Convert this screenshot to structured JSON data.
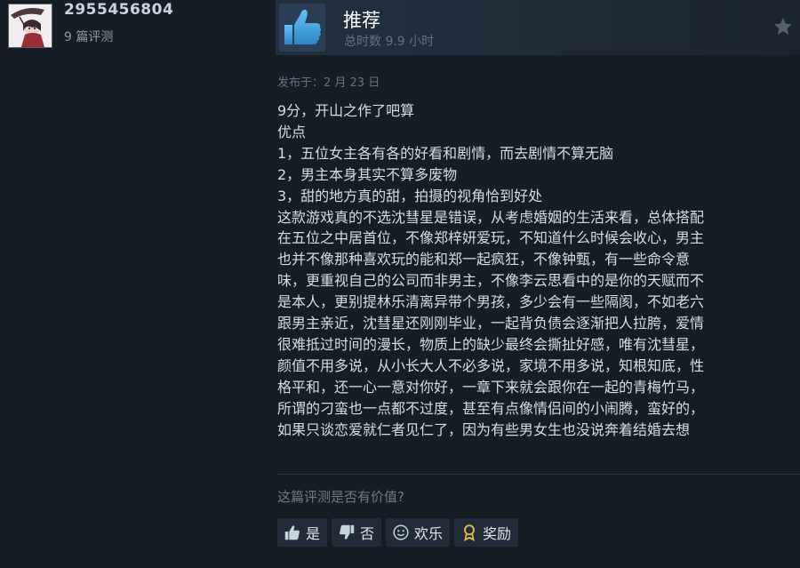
{
  "author": {
    "name": "2955456804",
    "review_count": "9 篇评测"
  },
  "review": {
    "verdict": "推荐",
    "playtime": "总时数 9.9 小时",
    "posted": "发布于：2 月 23 日",
    "lines": [
      "9分，开山之作了吧算",
      "优点",
      "1，五位女主各有各的好看和剧情，而去剧情不算无脑",
      "2，男主本身其实不算多废物",
      "3，甜的地方真的甜，拍摄的视角恰到好处",
      "这款游戏真的不选沈彗星是错误，从考虑婚姻的生活来看，总体搭配",
      "在五位之中居首位，不像郑梓妍爱玩，不知道什么时候会收心，男主",
      "也并不像那种喜欢玩的能和郑一起疯狂，不像钟甄，有一些命令意",
      "味，更重视自己的公司而非男主，不像李云思看中的是你的天赋而不",
      "是本人，更别提林乐清离异带个男孩，多少会有一些隔阂，不如老六",
      "跟男主亲近，沈彗星还刚刚毕业，一起背负债会逐渐把人拉胯，爱情",
      "很难抵过时间的漫长，物质上的缺少最终会撕扯好感，唯有沈彗星，",
      "颜值不用多说，从小长大人不必多说，家境不用多说，知根知底，性",
      "格平和，还一心一意对你好，一章下来就会跟你在一起的青梅竹马，",
      "所谓的刁蛮也一点都不过度，甚至有点像情侣间的小闹腾，蛮好的，",
      "如果只谈恋爱就仁者见仁了，因为有些男女生也没说奔着结婚去想"
    ]
  },
  "feedback": {
    "question": "这篇评测是否有价值?",
    "yes": "是",
    "no": "否",
    "funny": "欢乐",
    "award": "奖励"
  },
  "colors": {
    "background": "#161d25",
    "header": "#22303e",
    "thumb_blue": "#4ea6e0",
    "button": "#212c38",
    "award_gold": "#e8b64a"
  }
}
